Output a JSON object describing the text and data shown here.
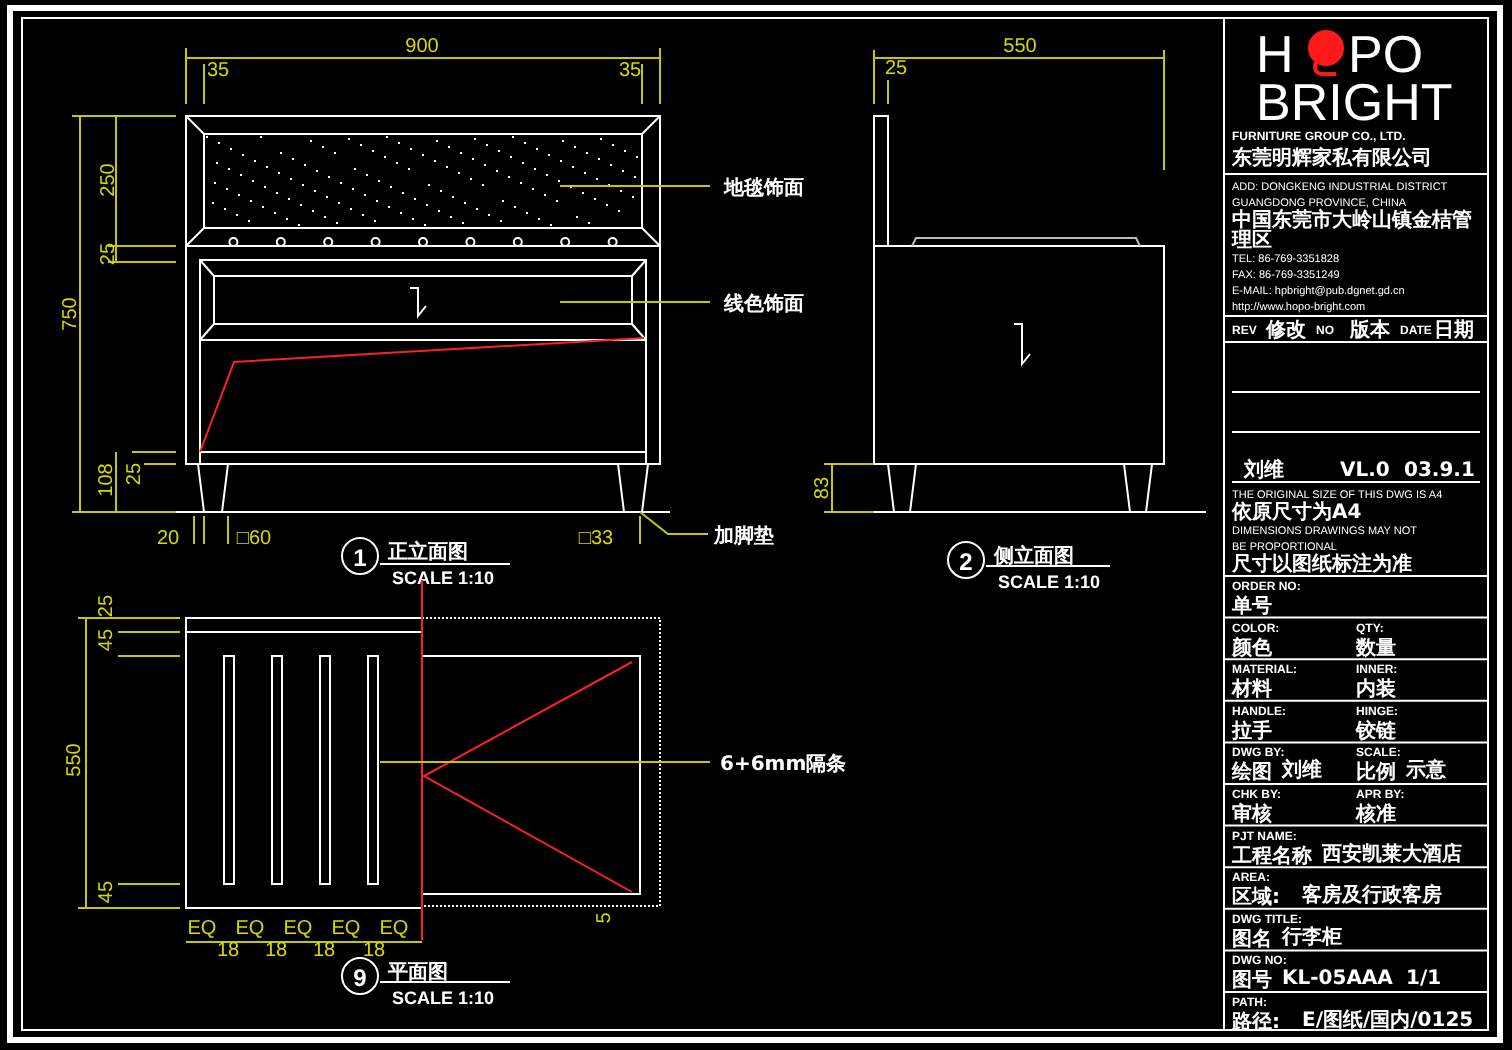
{
  "logo": {
    "left": "H",
    "right": "PO",
    "word": "BRIGHT"
  },
  "company": {
    "name_en": "FURNITURE GROUP CO., LTD.",
    "name_zh": "东莞明辉家私有限公司"
  },
  "contact_lines": [
    {
      "text": "ADD: DONGKENG INDUSTRIAL DISTRICT",
      "kind": "latin"
    },
    {
      "text": "GUANGDONG PROVINCE, CHINA",
      "kind": "latin"
    },
    {
      "text": "中国东莞市大岭山镇金桔管理区",
      "kind": "cjk"
    },
    {
      "text": "TEL: 86-769-3351828",
      "kind": "latin"
    },
    {
      "text": "FAX: 86-769-3351249",
      "kind": "latin"
    },
    {
      "text": "E-MAIL: hpbright@pub.dgnet.gd.cn",
      "kind": "latin"
    },
    {
      "text": "http://www.hopo-bright.com",
      "kind": "latin"
    }
  ],
  "revision": {
    "headers": [
      {
        "en": "REV",
        "zh": "修改"
      },
      {
        "en": "NO",
        "zh": "版本"
      },
      {
        "en": "DATE",
        "zh": "日期"
      }
    ],
    "rows": [
      [
        "刘维",
        "VL.0",
        "03.9.1"
      ]
    ]
  },
  "notes": [
    {
      "text": "THE ORIGINAL SIZE OF THIS DWG IS A4",
      "kind": "latin"
    },
    {
      "text": "依原尺寸为A4",
      "kind": "cjk"
    },
    {
      "text": "DIMENSIONS DRAWINGS MAY NOT",
      "kind": "latin"
    },
    {
      "text": "BE PROPORTIONAL",
      "kind": "latin"
    },
    {
      "text": "尺寸以图纸标注为准",
      "kind": "cjk"
    }
  ],
  "info_rows": [
    [
      {
        "label": "ORDER NO:",
        "sub": "单号"
      }
    ],
    [
      {
        "label": "COLOR:",
        "sub": "颜色"
      },
      {
        "label": "QTY:",
        "sub": "数量"
      }
    ],
    [
      {
        "label": "MATERIAL:",
        "sub": "材料"
      },
      {
        "label": "INNER:",
        "sub": "内装"
      }
    ],
    [
      {
        "label": "HANDLE:",
        "sub": "拉手"
      },
      {
        "label": "HINGE:",
        "sub": "铰链"
      }
    ],
    [
      {
        "label": "DWG BY:",
        "sub": "绘图",
        "values": [
          "刘维"
        ]
      },
      {
        "label": "SCALE:",
        "sub": "比例",
        "values": [
          "示意"
        ]
      }
    ],
    [
      {
        "label": "CHK BY:",
        "sub": "审核"
      },
      {
        "label": "APR BY:",
        "sub": "核准"
      }
    ],
    [
      {
        "label": "PJT NAME:",
        "sub": "工程名称",
        "values": [
          "西安凯莱大酒店"
        ]
      }
    ],
    [
      {
        "label": "AREA:",
        "sub": "区域:",
        "values": [
          "客房及行政客房"
        ]
      }
    ],
    [
      {
        "label": "DWG TITLE:",
        "sub": "图名",
        "values": [
          "行李柜"
        ]
      }
    ],
    [
      {
        "label": "DWG NO:",
        "sub": "图号",
        "values": [
          "KL-05AAA",
          "1/1"
        ]
      }
    ],
    [
      {
        "label": "PATH:",
        "sub": "路径:",
        "values": [
          "E/图纸/国内/0125"
        ]
      }
    ]
  ],
  "views": [
    {
      "kind": "front",
      "number": "1",
      "title": "正立面图",
      "scale": "SCALE 1:10",
      "dims": [
        "900",
        "35",
        "35",
        "250",
        "25",
        "750",
        "25",
        "108",
        "20",
        "□60",
        "□33"
      ],
      "callouts": [
        "地毯饰面",
        "线色饰面",
        "加脚垫"
      ]
    },
    {
      "kind": "side",
      "number": "2",
      "title": "侧立面图",
      "scale": "SCALE 1:10",
      "dims": [
        "550",
        "25",
        "83"
      ]
    },
    {
      "kind": "plan",
      "number": "9",
      "title": "平面图",
      "scale": "SCALE 1:10",
      "dims": [
        "25",
        "45",
        "550",
        "45",
        "EQ",
        "EQ",
        "EQ",
        "EQ",
        "EQ",
        "18",
        "18",
        "18",
        "18",
        "5"
      ],
      "callouts": [
        "6+6mm隔条"
      ]
    }
  ]
}
